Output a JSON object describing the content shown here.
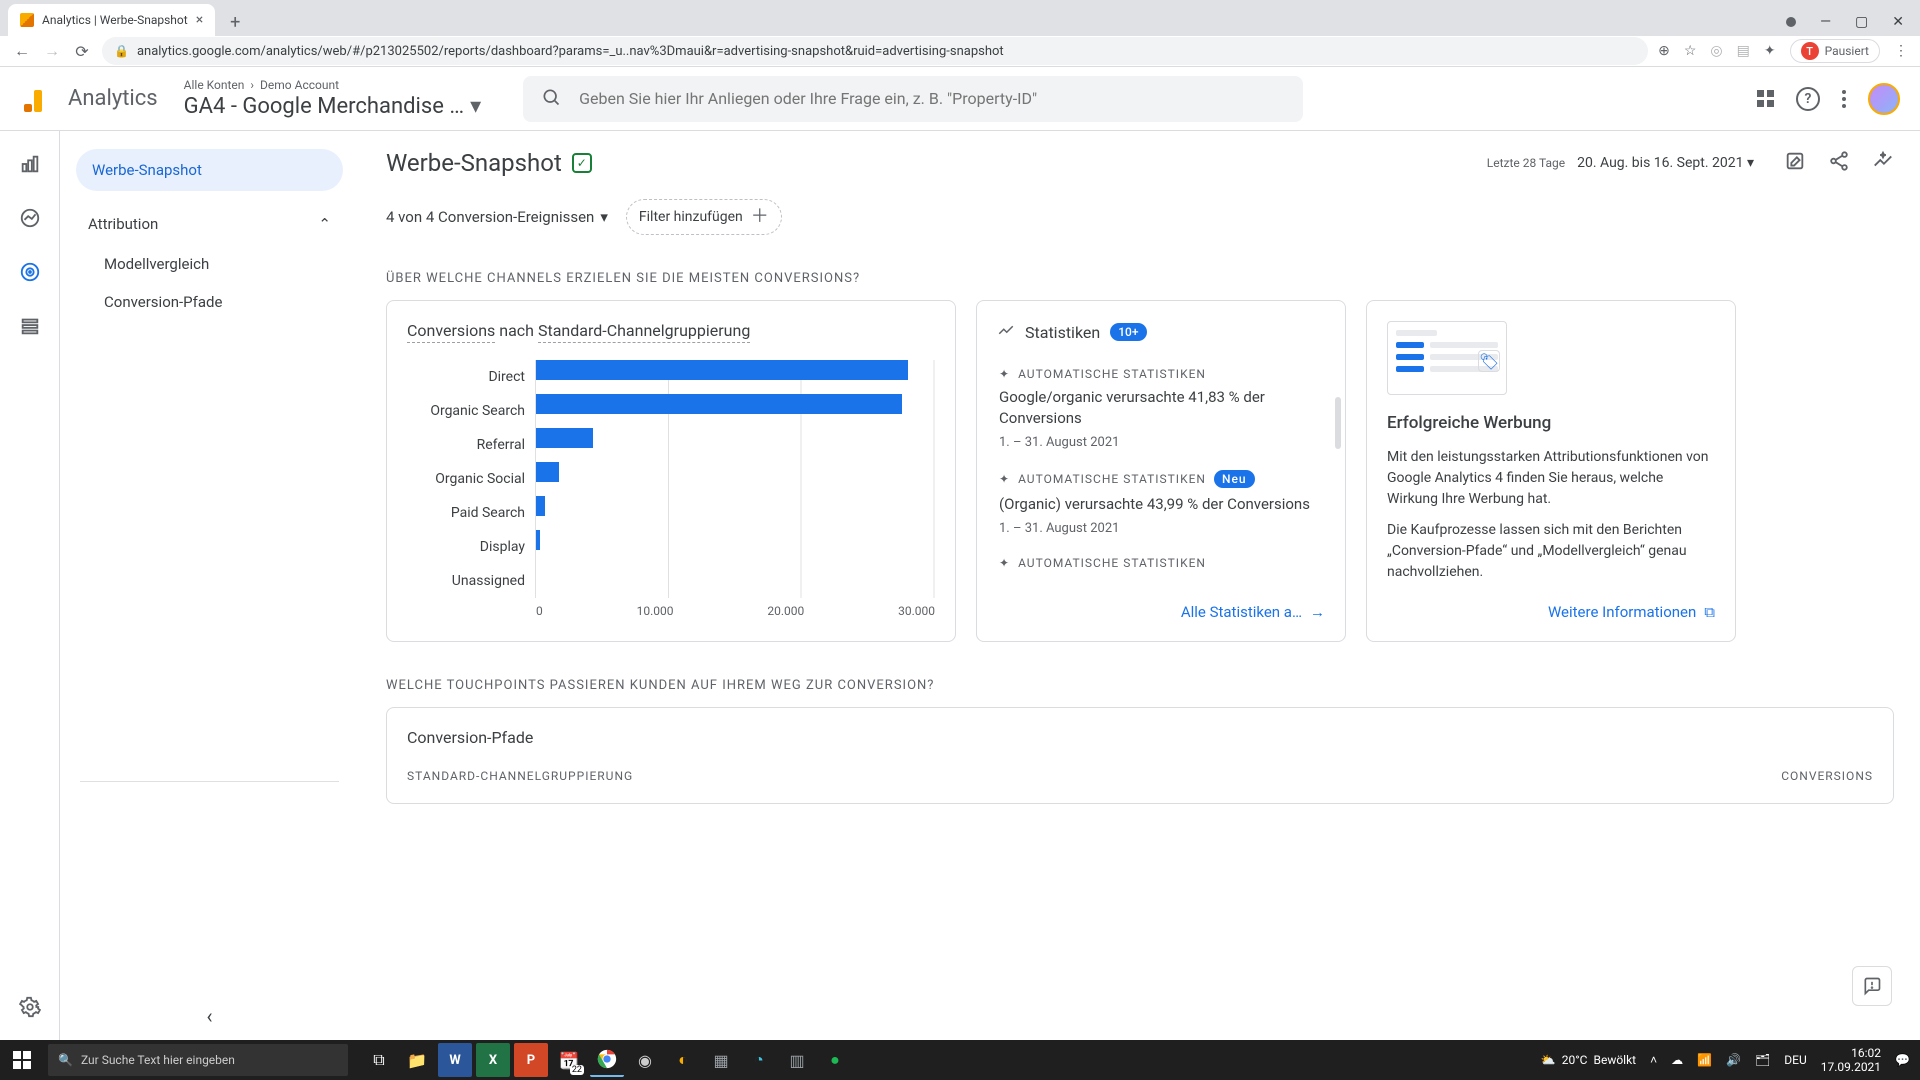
{
  "browser": {
    "tab_title": "Analytics | Werbe-Snapshot",
    "url": "analytics.google.com/analytics/web/#/p213025502/reports/dashboard?params=_u..nav%3Dmaui&r=advertising-snapshot&ruid=advertising-snapshot",
    "profile_state": "Pausiert",
    "profile_initial": "T"
  },
  "header": {
    "brand": "Analytics",
    "crumb_all": "Alle Konten",
    "crumb_acct": "Demo Account",
    "property": "GA4 - Google Merchandise …",
    "search_placeholder": "Geben Sie hier Ihr Anliegen oder Ihre Frage ein, z. B. \"Property-ID\""
  },
  "sidebar": {
    "active": "Werbe-Snapshot",
    "group": "Attribution",
    "items": [
      "Modellvergleich",
      "Conversion-Pfade"
    ]
  },
  "page": {
    "title": "Werbe-Snapshot",
    "range_label": "Letzte 28 Tage",
    "range_value": "20. Aug. bis 16. Sept. 2021",
    "conv_selector": "4 von 4 Conversion-Ereignissen",
    "filter_add": "Filter hinzufügen"
  },
  "section1": {
    "heading": "ÜBER WELCHE CHANNELS ERZIELEN SIE DIE MEISTEN CONVERSIONS?"
  },
  "chart_data": {
    "type": "bar",
    "title_metric": "Conversions",
    "title_mid": " nach ",
    "title_dim": "Standard-Channelgruppierung",
    "categories": [
      "Direct",
      "Organic Search",
      "Referral",
      "Organic Social",
      "Paid Search",
      "Display",
      "Unassigned"
    ],
    "values": [
      28000,
      27500,
      4300,
      1700,
      700,
      300,
      0
    ],
    "xlim": [
      0,
      30000
    ],
    "xticks": [
      "0",
      "10.000",
      "20.000",
      "30.000"
    ]
  },
  "stats": {
    "title": "Statistiken",
    "badge": "10+",
    "auto_label": "AUTOMATISCHE STATISTIKEN",
    "neu_label": "Neu",
    "items": [
      {
        "title": "Google/organic verursachte 41,83 % der Conversions",
        "sub": "1. – 31. August 2021",
        "neu": false
      },
      {
        "title": "(Organic) verursachte 43,99 % der Conversions",
        "sub": "1. – 31. August 2021",
        "neu": true
      }
    ],
    "link": "Alle Statistiken a…"
  },
  "promo": {
    "title": "Erfolgreiche Werbung",
    "p1": "Mit den leistungsstarken Attributionsfunktionen von Google Analytics 4 finden Sie heraus, welche Wirkung Ihre Werbung hat.",
    "p2": "Die Kaufprozesse lassen sich mit den Berichten „Conversion-Pfade“ und „Modellvergleich“ genau nachvollziehen.",
    "link": "Weitere Informationen"
  },
  "section2": {
    "heading": "WELCHE TOUCHPOINTS PASSIEREN KUNDEN AUF IHREM WEG ZUR CONVERSION?",
    "card_title": "Conversion-Pfade",
    "col_left": "STANDARD-CHANNELGRUPPIERUNG",
    "col_right": "CONVERSIONS"
  },
  "taskbar": {
    "search_placeholder": "Zur Suche Text hier eingeben",
    "weather_temp": "20°C",
    "weather_word": "Bewölkt",
    "lang": "DEU",
    "time": "16:02",
    "date": "17.09.2021",
    "calendar_badge": "22"
  }
}
